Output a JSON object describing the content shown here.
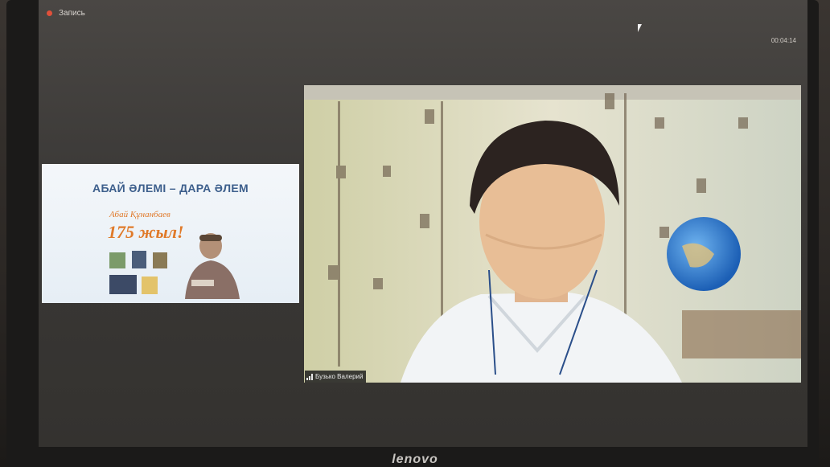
{
  "toolbar": {
    "recording_label": "Запись",
    "clock": "00:04:14"
  },
  "slide": {
    "title": "АБАЙ ӘЛЕМІ – ДАРА ӘЛЕМ",
    "subtitle": "Абай Құнанбаев",
    "anniversary": "175 жыл!"
  },
  "video": {
    "participant_name": "Бузько Валерий"
  },
  "device": {
    "brand": "lenovo"
  },
  "colors": {
    "record": "#e0503a",
    "slide_title": "#3d5f8c",
    "anniversary": "#e07a2a"
  }
}
